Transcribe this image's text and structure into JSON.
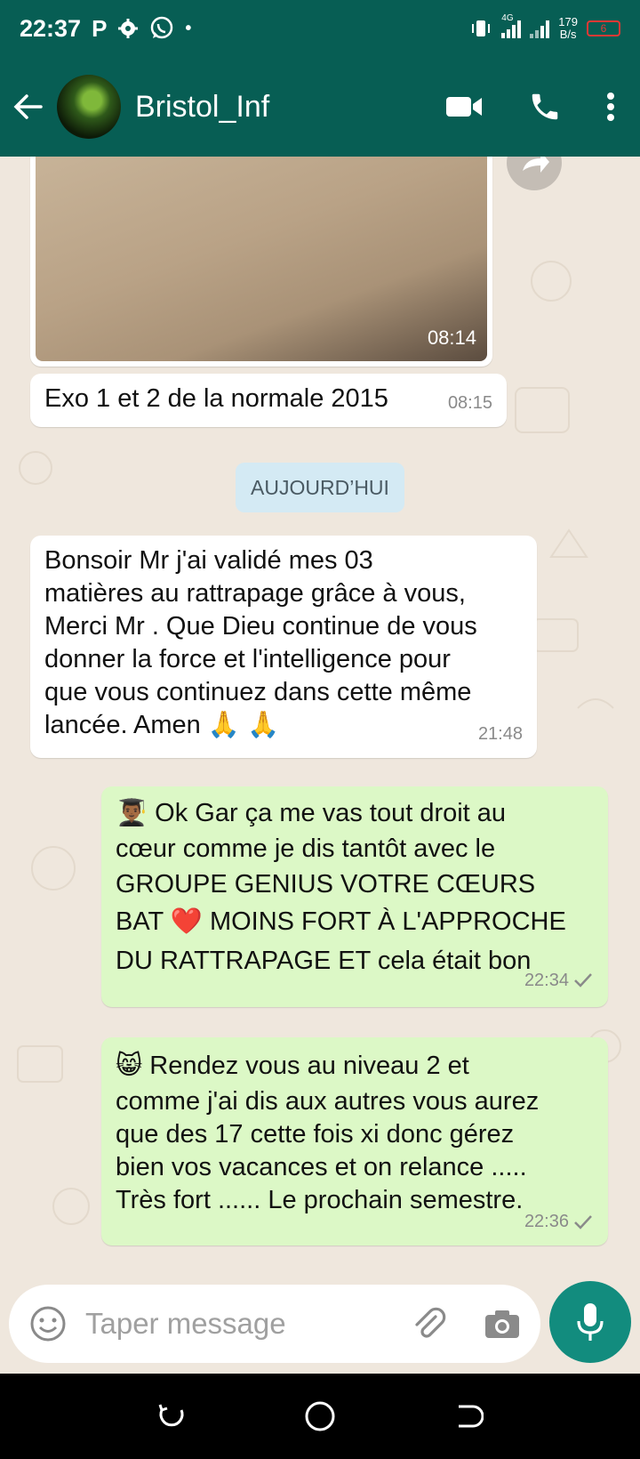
{
  "status": {
    "time": "22:37",
    "speed_value": "179",
    "speed_unit": "B/s",
    "battery": "6",
    "network": "4G"
  },
  "header": {
    "contact_name": "Bristol_Inf"
  },
  "messages": {
    "image": {
      "time": "08:14"
    },
    "caption": {
      "text": "Exo 1 et 2 de la normale 2015",
      "time": "08:15"
    },
    "date_divider": "AUJOURD’HUI",
    "incoming": {
      "line1": "Bonsoir Mr j'ai validé mes 03",
      "line2": "matières au rattrapage grâce à vous,",
      "line3": "Merci Mr . Que Dieu continue de vous",
      "line4": "donner la force et l'intelligence pour",
      "line5": "que vous continuez dans cette même",
      "line6": "lancée. Amen 🙏 🙏",
      "time": "21:48"
    },
    "out1": {
      "line1": "👨🏾‍🎓 Ok Gar ça me vas tout droit au",
      "line2": "cœur comme je dis tantôt avec le",
      "line3": "GROUPE GENIUS VOTRE CŒURS",
      "line4": "BAT ❤️ MOINS FORT À L'APPROCHE",
      "line5": "DU RATTRAPAGE ET cela était bon",
      "time": "22:34"
    },
    "out2": {
      "line1": "😸 Rendez vous au niveau 2 et",
      "line2": "comme j'ai dis aux autres vous aurez",
      "line3": "que des 17 cette fois xi donc gérez",
      "line4": "bien vos vacances et on relance .....",
      "line5": "Très fort ...... Le prochain semestre.",
      "time": "22:36"
    }
  },
  "input": {
    "placeholder": "Taper message"
  },
  "colors": {
    "header": "#075e54",
    "outgoing_bubble": "#dcf8c6",
    "incoming_bubble": "#ffffff",
    "mic_button": "#128c7e",
    "chat_background": "#efe7dd"
  }
}
